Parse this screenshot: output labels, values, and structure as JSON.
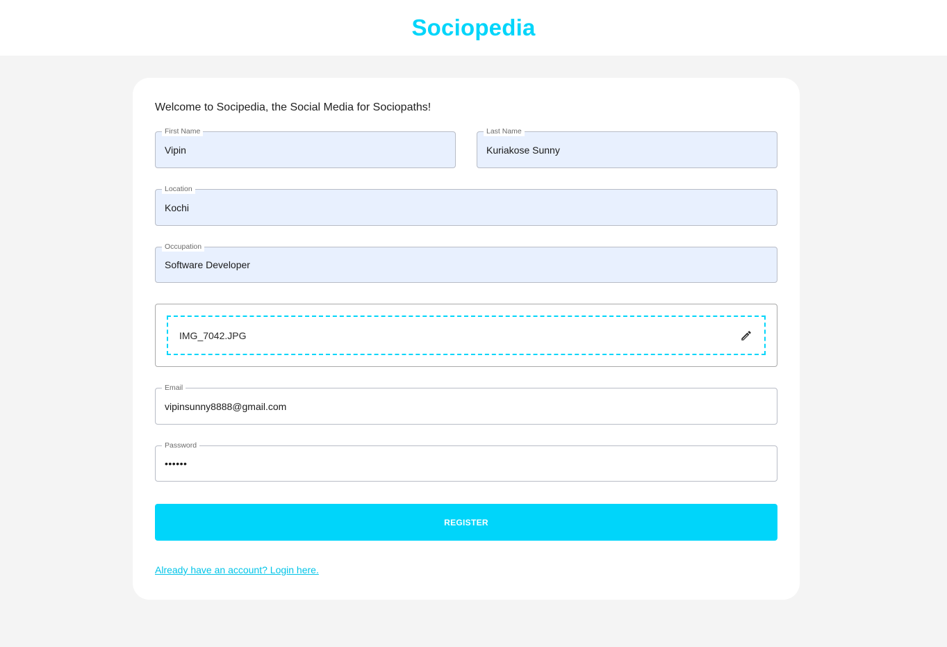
{
  "header": {
    "brand": "Sociopedia"
  },
  "form": {
    "welcome": "Welcome to Socipedia, the Social Media for Sociopaths!",
    "first_name": {
      "label": "First Name",
      "value": "Vipin"
    },
    "last_name": {
      "label": "Last Name",
      "value": "Kuriakose Sunny"
    },
    "location": {
      "label": "Location",
      "value": "Kochi"
    },
    "occupation": {
      "label": "Occupation",
      "value": "Software Developer"
    },
    "picture": {
      "file_name": "IMG_7042.JPG",
      "icon": "edit-pencil-icon"
    },
    "email": {
      "label": "Email",
      "value": "vipinsunny8888@gmail.com"
    },
    "password": {
      "label": "Password",
      "value": "••••••"
    },
    "register_label": "REGISTER",
    "login_link": "Already have an account? Login here."
  },
  "colors": {
    "accent": "#00d5fa",
    "background": "#f4f4f4",
    "autofill": "#e8f0fe"
  }
}
